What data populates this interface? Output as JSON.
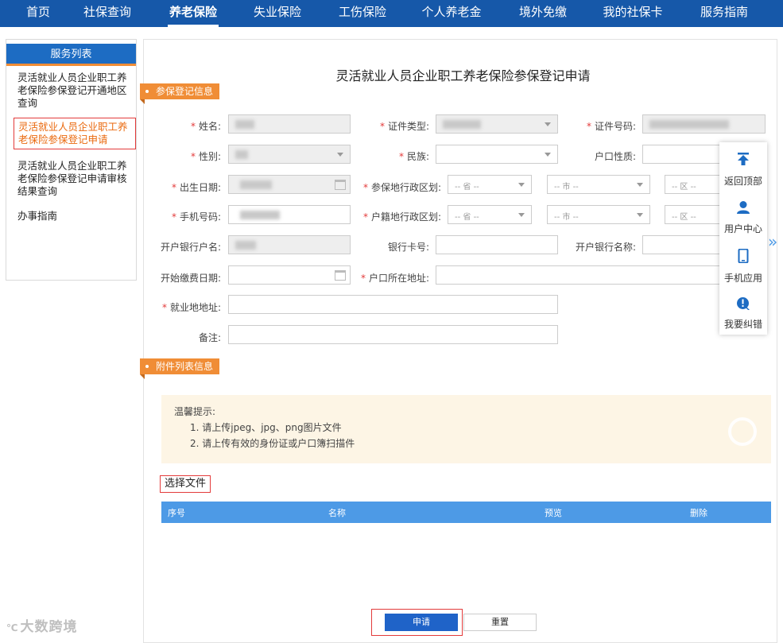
{
  "nav": {
    "items": [
      "首页",
      "社保查询",
      "养老保险",
      "失业保险",
      "工伤保险",
      "个人养老金",
      "境外免缴",
      "我的社保卡",
      "服务指南"
    ],
    "active_index": 2
  },
  "sidebar": {
    "title": "服务列表",
    "items": [
      "灵活就业人员企业职工养老保险参保登记开通地区查询",
      "灵活就业人员企业职工养老保险参保登记申请",
      "灵活就业人员企业职工养老保险参保登记申请审核结果查询",
      "办事指南"
    ],
    "selected_index": 1
  },
  "page_title": "灵活就业人员企业职工养老保险参保登记申请",
  "section1": "参保登记信息",
  "section2": "附件列表信息",
  "form": {
    "name_label": "姓名:",
    "id_type_label": "证件类型:",
    "id_number_label": "证件号码:",
    "gender_label": "性别:",
    "ethnic_label": "民族:",
    "hukou_type_label": "户口性质:",
    "birth_label": "出生日期:",
    "insured_region_label": "参保地行政区划:",
    "phone_label": "手机号码:",
    "hukou_region_label": "户籍地行政区划:",
    "bank_account_name_label": "开户银行户名:",
    "bank_card_label": "银行卡号:",
    "bank_name_label": "开户银行名称:",
    "start_pay_label": "开始缴费日期:",
    "hukou_addr_label": "户口所在地址:",
    "work_addr_label": "就业地地址:",
    "remark_label": "备注:",
    "province_ph": "-- 省 --",
    "city_ph": "-- 市 --",
    "district_ph": "-- 区 --"
  },
  "tips": {
    "title": "温馨提示:",
    "line1": "1. 请上传jpeg、jpg、png图片文件",
    "line2": "2. 请上传有效的身份证或户口簿扫描件"
  },
  "choose_file": "选择文件",
  "table_headers": [
    "序号",
    "名称",
    "预览",
    "删除"
  ],
  "buttons": {
    "apply": "申请",
    "reset": "重置"
  },
  "float_menu": [
    "返回顶部",
    "用户中心",
    "手机应用",
    "我要纠错"
  ],
  "watermark": "大数跨境",
  "colors": {
    "nav": "#1658a9",
    "accent": "#f08d36",
    "table_head": "#4d9ae6",
    "primary_btn": "#1f63c8"
  }
}
